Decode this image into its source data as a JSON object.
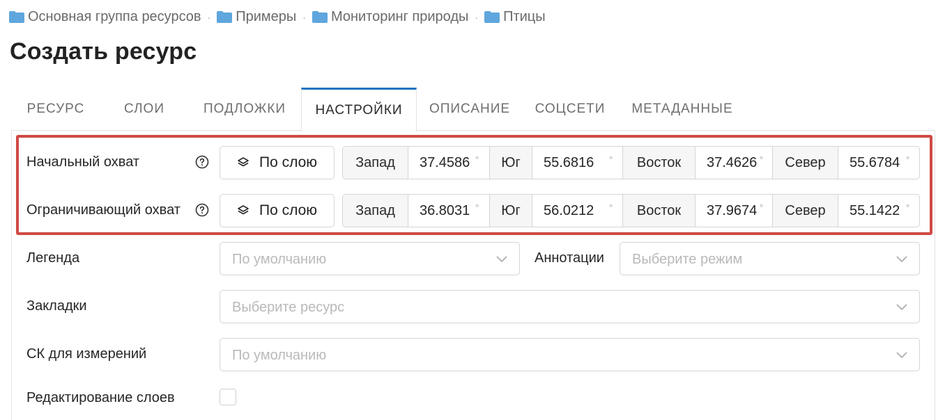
{
  "breadcrumb": {
    "items": [
      "Основная группа ресурсов",
      "Примеры",
      "Мониторинг природы",
      "Птицы"
    ],
    "separator": "·"
  },
  "page_title": "Создать ресурс",
  "tabs": [
    {
      "label": "РЕСУРС",
      "active": false
    },
    {
      "label": "СЛОИ",
      "active": false
    },
    {
      "label": "ПОДЛОЖКИ",
      "active": false
    },
    {
      "label": "НАСТРОЙКИ",
      "active": true
    },
    {
      "label": "ОПИСАНИЕ",
      "active": false
    },
    {
      "label": "СОЦСЕТИ",
      "active": false
    },
    {
      "label": "МЕТАДАННЫЕ",
      "active": false
    }
  ],
  "extent_rows": [
    {
      "label": "Начальный охват",
      "button_label": "По слою",
      "west_label": "Запад",
      "west": "37.4586",
      "south_label": "Юг",
      "south": "55.6816",
      "east_label": "Восток",
      "east": "37.4626",
      "north_label": "Север",
      "north": "55.6784"
    },
    {
      "label": "Ограничивающий охват",
      "button_label": "По слою",
      "west_label": "Запад",
      "west": "36.8031",
      "south_label": "Юг",
      "south": "56.0212",
      "east_label": "Восток",
      "east": "37.9674",
      "north_label": "Север",
      "north": "55.1422"
    }
  ],
  "degree_symbol": "°",
  "legend": {
    "label": "Легенда",
    "placeholder": "По умолчанию"
  },
  "annotations": {
    "label": "Аннотации",
    "placeholder": "Выберите режим"
  },
  "bookmarks": {
    "label": "Закладки",
    "placeholder": "Выберите ресурс"
  },
  "measure_srs": {
    "label": "СК для измерений",
    "placeholder": "По умолчанию"
  },
  "layer_editing": {
    "label": "Редактирование слоев",
    "checked": false
  },
  "colors": {
    "accent": "#1b74c0",
    "highlight_border": "#d04a45",
    "folder": "#5ea6dd"
  },
  "icons": {
    "folder": "folder-icon",
    "help": "question-circle-icon",
    "layers": "layers-icon",
    "chevron": "chevron-down-icon"
  }
}
